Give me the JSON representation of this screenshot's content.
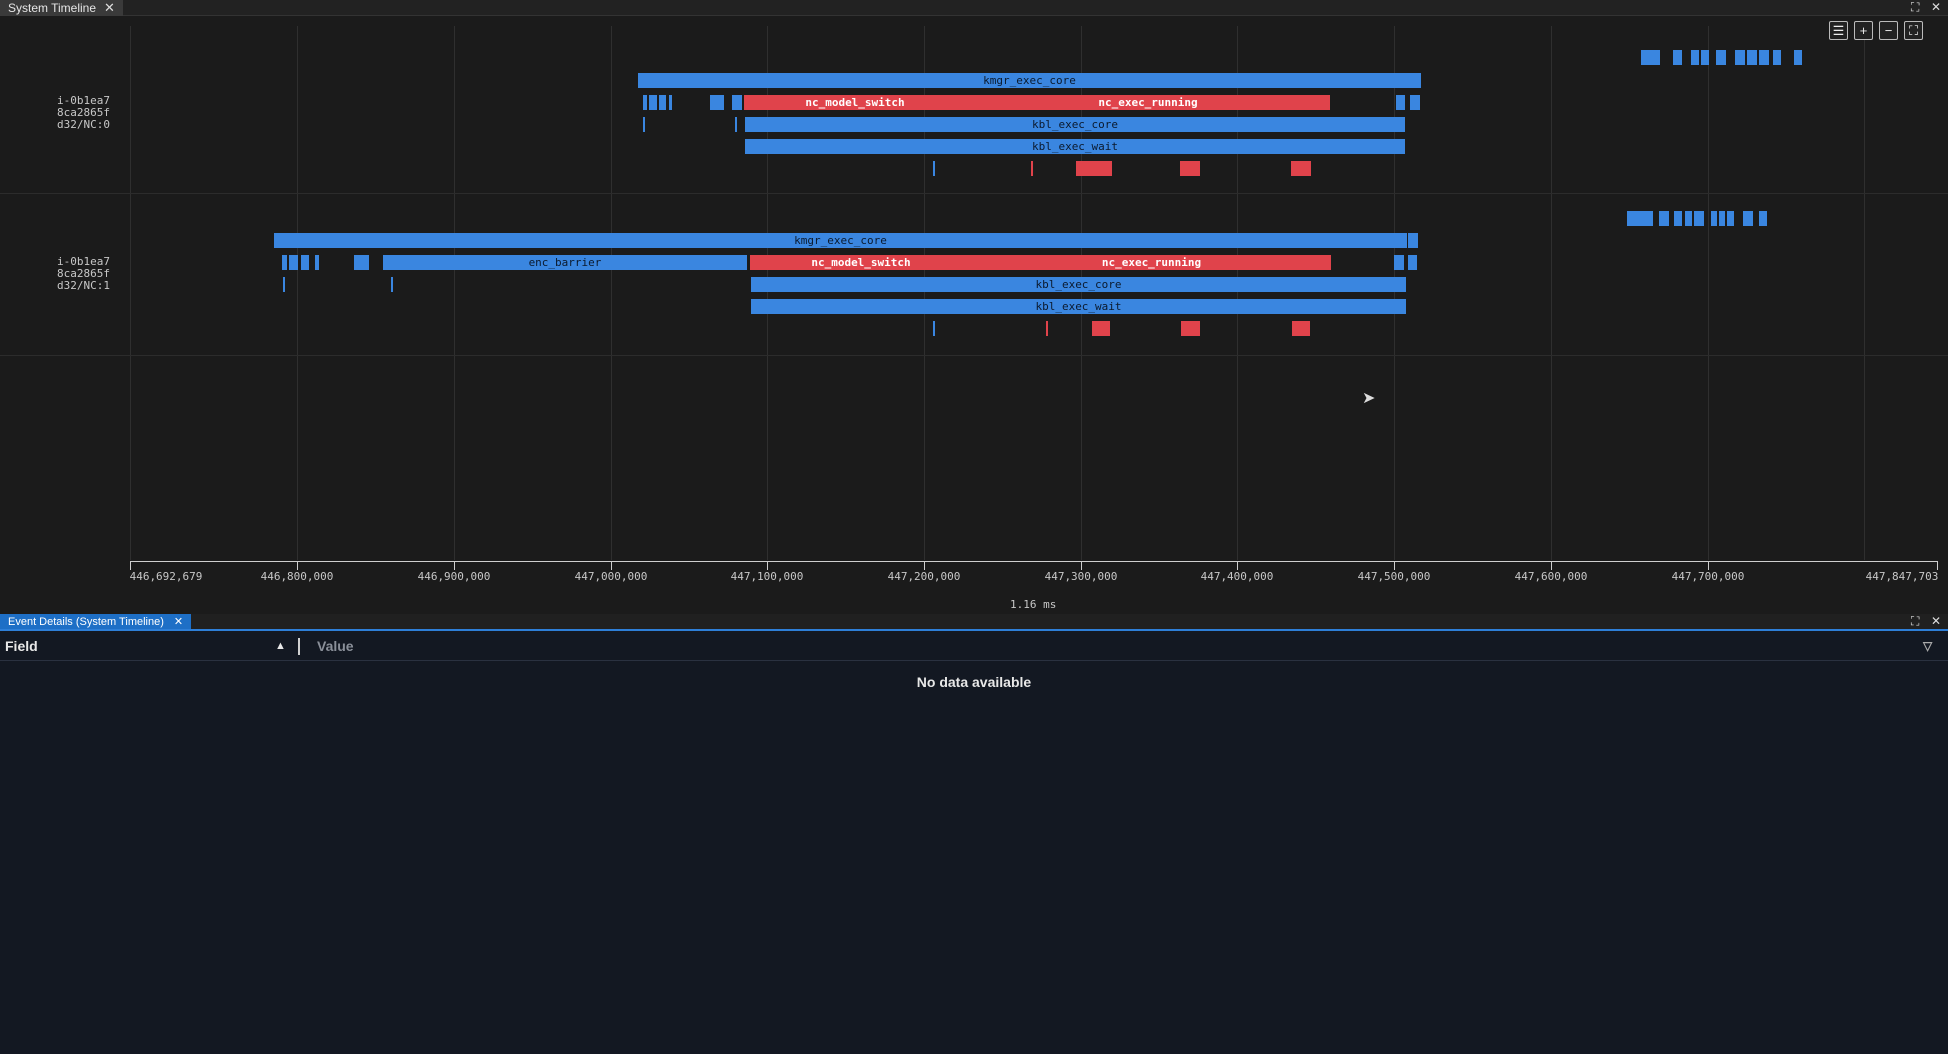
{
  "tabs": {
    "timeline_tab": "System Timeline",
    "details_tab": "Event Details (System Timeline)"
  },
  "icons": {
    "close": "close-icon",
    "maximize": "maximize-icon",
    "list": "list-icon",
    "zoom_in": "plus-icon",
    "zoom_out": "minus-icon",
    "fit": "fit-icon"
  },
  "rows": [
    {
      "label_lines": [
        "i-0b1ea7",
        "8ca2865f",
        "d32/NC:0"
      ]
    },
    {
      "label_lines": [
        "i-0b1ea7",
        "8ca2865f",
        "d32/NC:1"
      ]
    }
  ],
  "events": {
    "kmgr_exec_core": "kmgr_exec_core",
    "nc_model_switch": "nc_model_switch",
    "nc_exec_running": "nc_exec_running",
    "kbl_exec_core": "kbl_exec_core",
    "kbl_exec_wait": "kbl_exec_wait",
    "enc_barrier": "enc_barrier"
  },
  "axis": {
    "labels": [
      "446,692,679",
      "446,800,000",
      "446,900,000",
      "447,000,000",
      "447,100,000",
      "447,200,000",
      "447,300,000",
      "447,400,000",
      "447,500,000",
      "447,600,000",
      "447,700,000",
      "447,847,703"
    ],
    "span": "1.16 ms"
  },
  "details": {
    "field_header": "Field",
    "value_header": "Value",
    "empty_text": "No data available"
  },
  "colors": {
    "blue": "#3a86e0",
    "red": "#e0434b",
    "accent": "#1e6fc6"
  }
}
